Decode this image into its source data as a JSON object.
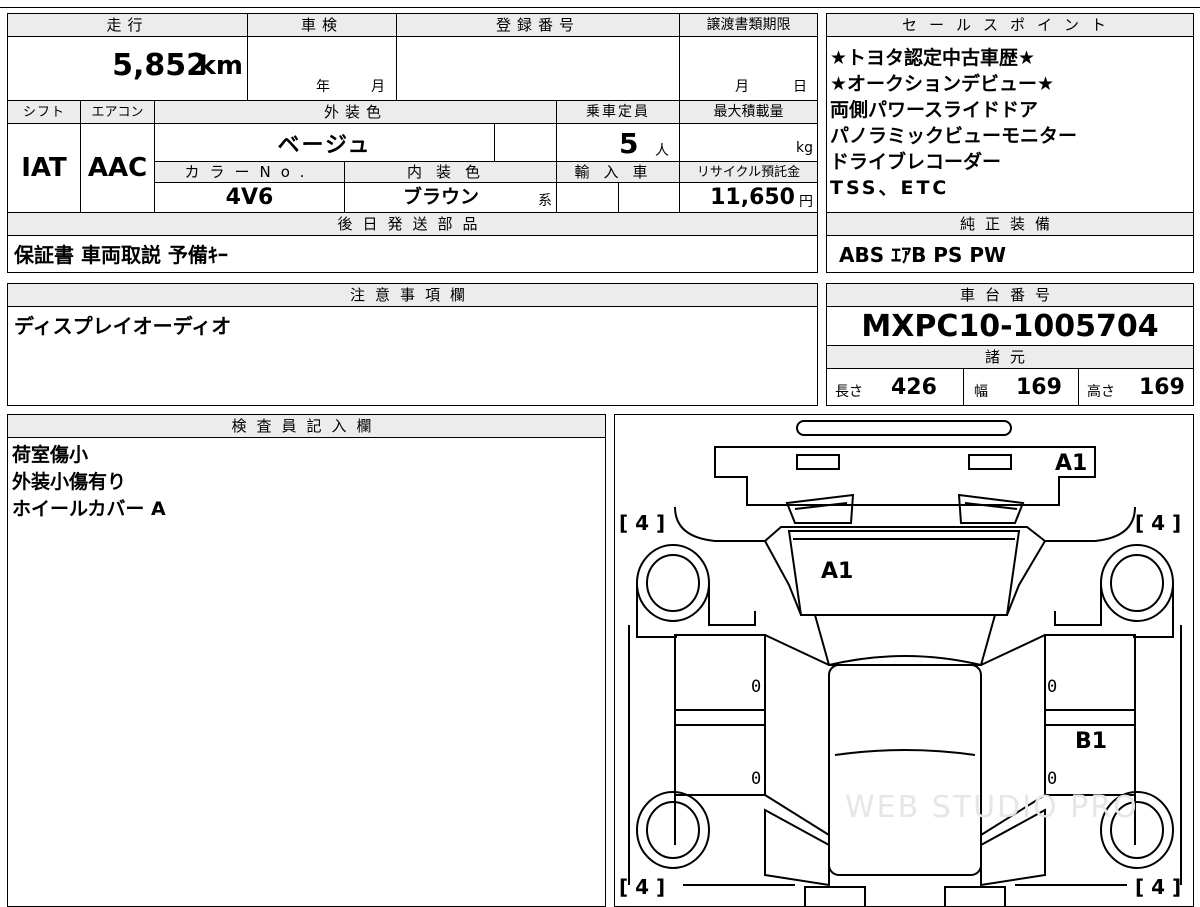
{
  "top": {
    "mileage_header": "走行",
    "inspection_header": "車検",
    "registration_header": "登録番号",
    "transfer_deadline_header": "譲渡書類期限",
    "mileage_value": "5,852",
    "mileage_unit": "km",
    "year_label": "年",
    "month_label": "月",
    "deadline_month_label": "月",
    "deadline_day_label": "日",
    "shift_header": "シフト",
    "aircon_header": "エアコン",
    "exterior_color_header": "外装色",
    "capacity_header": "乗車定員",
    "max_load_header": "最大積載量",
    "shift_value": "IAT",
    "aircon_value": "AAC",
    "exterior_color_value": "ベージュ",
    "capacity_value": "5",
    "capacity_unit": "人",
    "max_load_unit": "kg",
    "color_no_header": "カラーNo.",
    "interior_color_header": "内装色",
    "import_header": "輸入車",
    "recycle_header": "リサイクル預託金",
    "color_no_value": "4V6",
    "interior_color_value": "ブラウン",
    "interior_color_suffix": "系",
    "recycle_value": "11,650",
    "recycle_unit": "円",
    "later_parts_header": "後日発送部品",
    "later_parts_value": "保証書 車両取説 予備ｷｰ"
  },
  "sales_points": {
    "header": "セールスポイント",
    "lines": [
      "★トヨタ認定中古車歴★",
      "★オークションデビュー★",
      "両側パワースライドドア",
      "パノラミックビューモニター",
      "ドライブレコーダー",
      "TSS、ETC"
    ]
  },
  "genuine_equipment": {
    "header": "純正装備",
    "value": "ABS ｴｱB PS PW"
  },
  "notes": {
    "header": "注意事項欄",
    "value": "ディスプレイオーディオ"
  },
  "chassis": {
    "header": "車台番号",
    "value": "MXPC10-1005704"
  },
  "specs": {
    "header": "諸元",
    "length_label": "長さ",
    "length_value": "426",
    "width_label": "幅",
    "width_value": "169",
    "height_label": "高さ",
    "height_value": "169"
  },
  "inspector": {
    "header": "検査員記入欄",
    "lines": [
      "荷室傷小",
      "外装小傷有り",
      "ホイールカバー A"
    ]
  },
  "diagram": {
    "tire_marks": [
      "[ 4 ]",
      "[ 4 ]",
      "[ 4 ]",
      "[ 4 ]"
    ],
    "damage_labels": [
      "A1",
      "A1",
      "B1"
    ],
    "door_zero_labels": [
      "0",
      "0",
      "0",
      "0"
    ],
    "watermark": "WEB STUDIO PRO"
  }
}
